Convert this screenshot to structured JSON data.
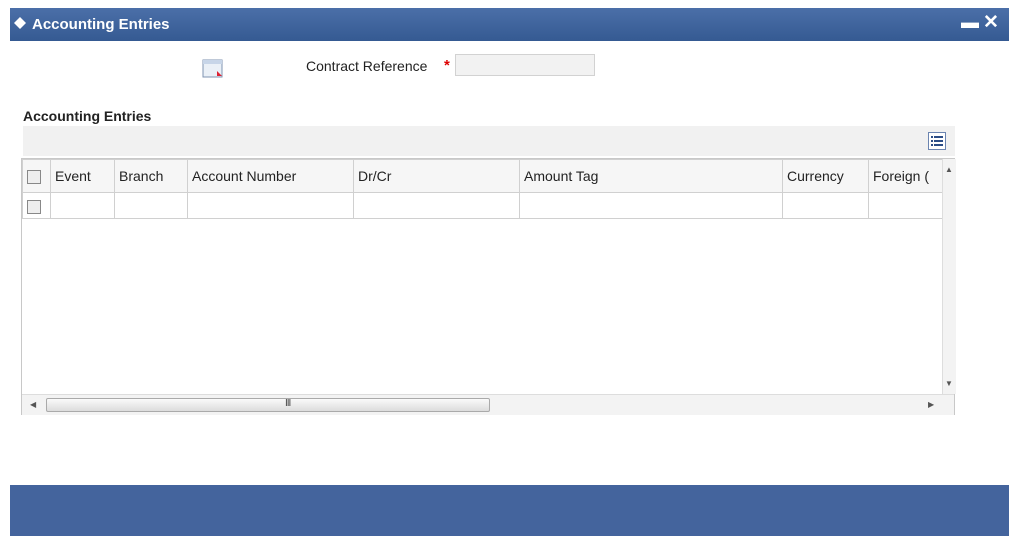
{
  "window": {
    "title": "Accounting Entries",
    "minimize_glyph": "▬",
    "close_glyph": "✕"
  },
  "form": {
    "contract_reference": {
      "label": "Contract Reference",
      "required_mark": "*",
      "value": ""
    }
  },
  "accounting_section": {
    "title": "Accounting Entries",
    "columns": [
      "Event",
      "Branch",
      "Account Number",
      "Dr/Cr",
      "Amount Tag",
      "Currency",
      "Foreign ("
    ],
    "rows": [
      [
        "",
        "",
        "",
        "",
        "",
        "",
        ""
      ]
    ],
    "scroll_grip": "III"
  },
  "icons": {
    "title": "diamond-icon",
    "form": "form-icon",
    "list_view": "list-view-icon"
  },
  "colors": {
    "titlebar": "#4b6fa8",
    "footer": "#44649d",
    "required": "#dd0000"
  }
}
